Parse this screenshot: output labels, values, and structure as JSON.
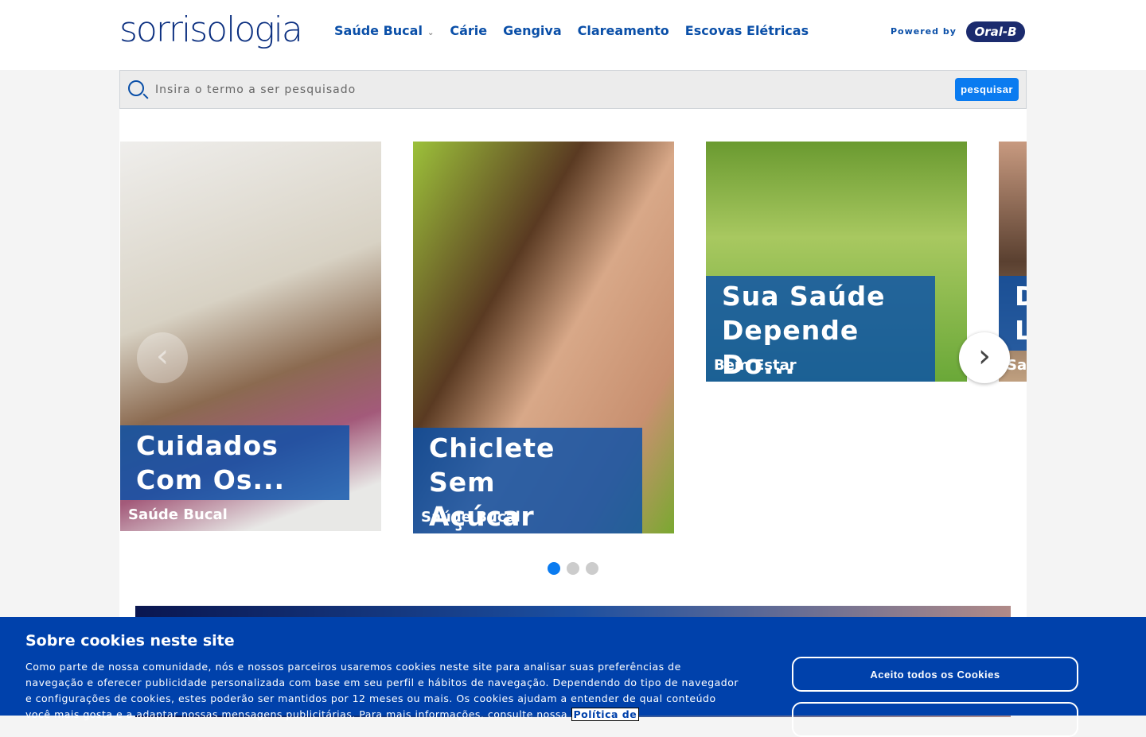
{
  "header": {
    "logo": "sorrisologia",
    "nav": [
      {
        "label": "Saúde Bucal",
        "dropdown": true
      },
      {
        "label": "Cárie"
      },
      {
        "label": "Gengiva"
      },
      {
        "label": "Clareamento"
      },
      {
        "label": "Escovas Elétricas"
      }
    ],
    "powered_by": "Powered by",
    "partner_logo": "Oral-B"
  },
  "search": {
    "placeholder": "Insira o termo a ser pesquisado",
    "button": "pesquisar"
  },
  "carousel": {
    "cards": [
      {
        "title1": "Cuidados",
        "title2": "Com Os...",
        "category": "Saúde Bucal"
      },
      {
        "title1": "Chiclete Sem",
        "title2": "Açúcar Não...",
        "category": "Saúde Bucal"
      },
      {
        "title1": "Sua Saúde",
        "title2": "Depende Do...",
        "category": "Bem Estar"
      },
      {
        "title1": "D",
        "title2": "L",
        "category": "Sa"
      }
    ],
    "active_page": 1,
    "pages": 3
  },
  "cookie": {
    "title": "Sobre cookies neste site",
    "text": "Como parte de nossa comunidade, nós e nossos parceiros usaremos cookies neste site para analisar suas preferências de navegação e oferecer publicidade personalizada com base em seu perfil e hábitos de navegação. Dependendo do tipo de navegador e configurações de cookies, estes poderão ser mantidos por 12 meses ou mais. Os cookies ajudam a entender de qual conteúdo você mais gosta e a adaptar nossas mensagens publicitárias. Para mais informações, consulte nossa",
    "link": "Política de",
    "accept": "Aceito todos os Cookies"
  },
  "colors": {
    "brand": "#0b2f80",
    "accent": "#0a7bf0",
    "cookie_bg": "#0041ab"
  }
}
